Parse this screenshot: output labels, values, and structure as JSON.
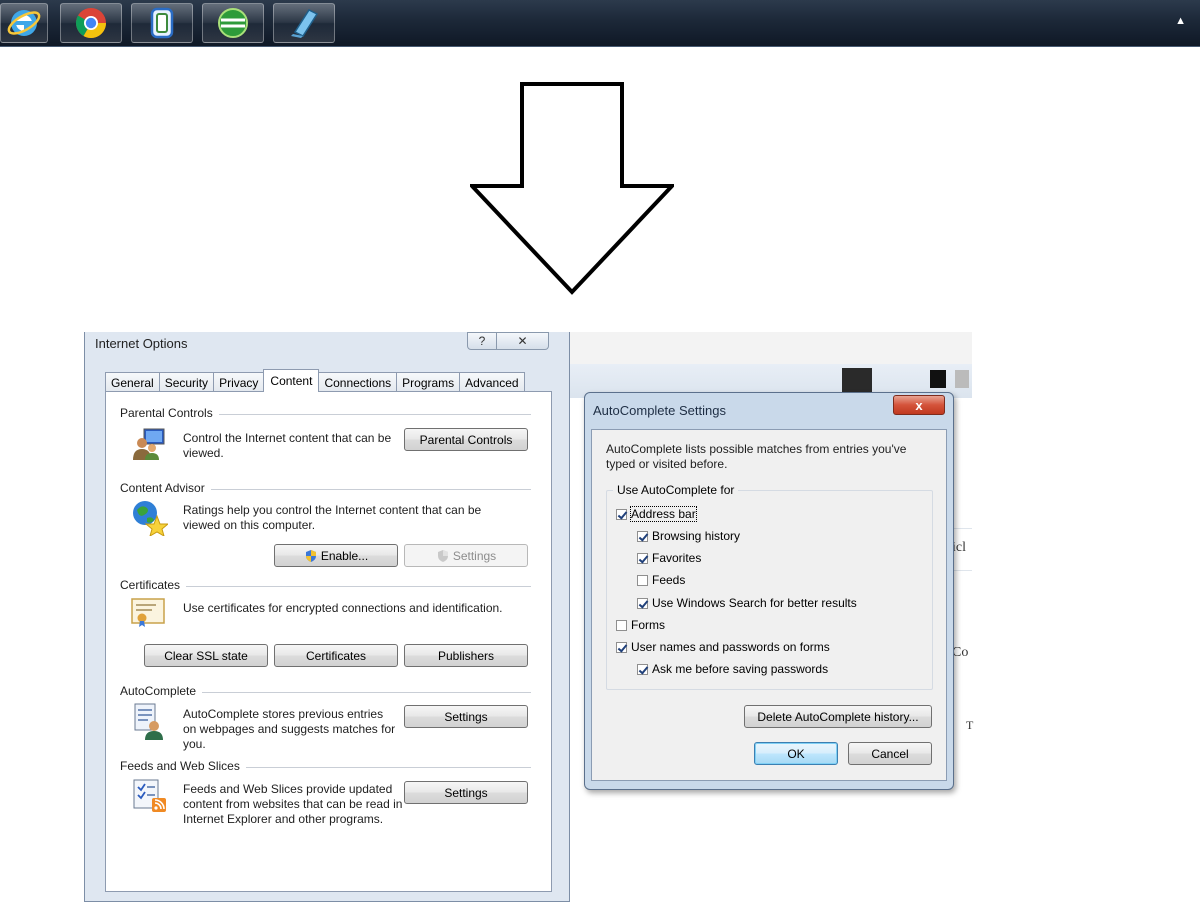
{
  "taskbar": {
    "apps": [
      {
        "icon": "internet-explorer-icon"
      },
      {
        "icon": "chrome-icon"
      },
      {
        "icon": "window-frame-icon"
      },
      {
        "icon": "green-globe-icon"
      },
      {
        "icon": "notebook-icon"
      }
    ],
    "tray_arrow": "▲"
  },
  "internet_options": {
    "title": "Internet Options",
    "help_label": "?",
    "close_label": "✕",
    "tabs": [
      "General",
      "Security",
      "Privacy",
      "Content",
      "Connections",
      "Programs",
      "Advanced"
    ],
    "active_tab": "Content",
    "parental": {
      "heading": "Parental Controls",
      "desc": "Control the Internet content that can be viewed.",
      "button": "Parental Controls"
    },
    "advisor": {
      "heading": "Content Advisor",
      "desc": "Ratings help you control the Internet content that can be viewed on this computer.",
      "enable_button": "Enable...",
      "settings_button": "Settings"
    },
    "certificates": {
      "heading": "Certificates",
      "desc": "Use certificates for encrypted connections and identification.",
      "clear_ssl_button": "Clear SSL state",
      "certificates_button": "Certificates",
      "publishers_button": "Publishers"
    },
    "autocomplete": {
      "heading": "AutoComplete",
      "desc": "AutoComplete stores previous entries on webpages and suggests matches for you.",
      "settings_button": "Settings"
    },
    "feeds": {
      "heading": "Feeds and Web Slices",
      "desc": "Feeds and Web Slices provide updated content from websites that can be read in Internet Explorer and other programs.",
      "settings_button": "Settings"
    }
  },
  "autocomplete_dialog": {
    "title": "AutoComplete Settings",
    "close_label": "x",
    "intro": "AutoComplete lists possible matches from entries you've typed or visited before.",
    "group_label": "Use AutoComplete for",
    "options": {
      "address_bar": {
        "label": "Address bar",
        "checked": true
      },
      "browsing_history": {
        "label": "Browsing history",
        "checked": true
      },
      "favorites": {
        "label": "Favorites",
        "checked": true
      },
      "feeds": {
        "label": "Feeds",
        "checked": false
      },
      "windows_search": {
        "label": "Use Windows Search for better results",
        "checked": true
      },
      "forms": {
        "label": "Forms",
        "checked": false
      },
      "user_names": {
        "label": "User names and passwords on forms",
        "checked": true
      },
      "ask_passwords": {
        "label": "Ask me before saving passwords",
        "checked": true
      }
    },
    "delete_button": "Delete AutoComplete history...",
    "ok_button": "OK",
    "cancel_button": "Cancel"
  },
  "background_fragments": {
    "frag1": "icl",
    "frag2": "Co",
    "frag3": "T"
  },
  "colors": {
    "taskbar": "#1c2838",
    "dialog_frame": "#dfe7f1",
    "close_button": "#d4533a",
    "checkmark": "#20407a"
  }
}
